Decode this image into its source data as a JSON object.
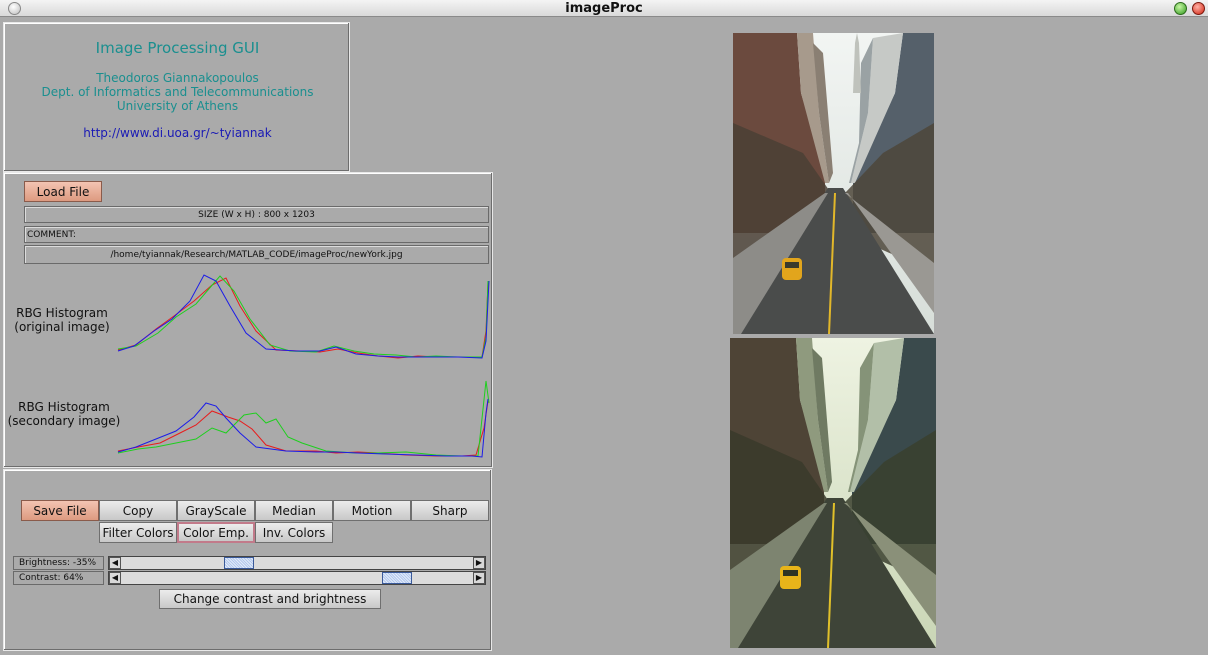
{
  "window": {
    "title": "imageProc"
  },
  "info": {
    "title": "Image Processing GUI",
    "author": "Theodoros Giannakopoulos",
    "dept": "Dept. of Informatics and Telecommunications",
    "univ": "University of Athens",
    "url": "http://www.di.uoa.gr/~tyiannak"
  },
  "file": {
    "load_label": "Load File",
    "size_text": "SIZE (W x H) : 800 x 1203",
    "comment_text": "COMMENT:",
    "path_text": "/home/tyiannak/Research/MATLAB_CODE/imageProc/newYork.jpg"
  },
  "histograms": {
    "original_label_1": "RBG Histogram",
    "original_label_2": "(original image)",
    "secondary_label_1": "RBG Histogram",
    "secondary_label_2": "(secondary image)",
    "colors": {
      "red": "#e81c1c",
      "green": "#1ecf1e",
      "blue": "#1c1ce8"
    }
  },
  "operations": {
    "save": "Save File",
    "copy": "Copy",
    "grayscale": "GrayScale",
    "median": "Median",
    "motion": "Motion",
    "sharp": "Sharp",
    "filter_colors": "Filter Colors",
    "color_emp": "Color Emp.",
    "inv_colors": "Inv. Colors",
    "change_cb": "Change contrast and brightness"
  },
  "sliders": {
    "brightness_label": "Brightness: -35%",
    "contrast_label": "Contrast:  64%",
    "brightness_value": -35,
    "contrast_value": 64
  }
}
